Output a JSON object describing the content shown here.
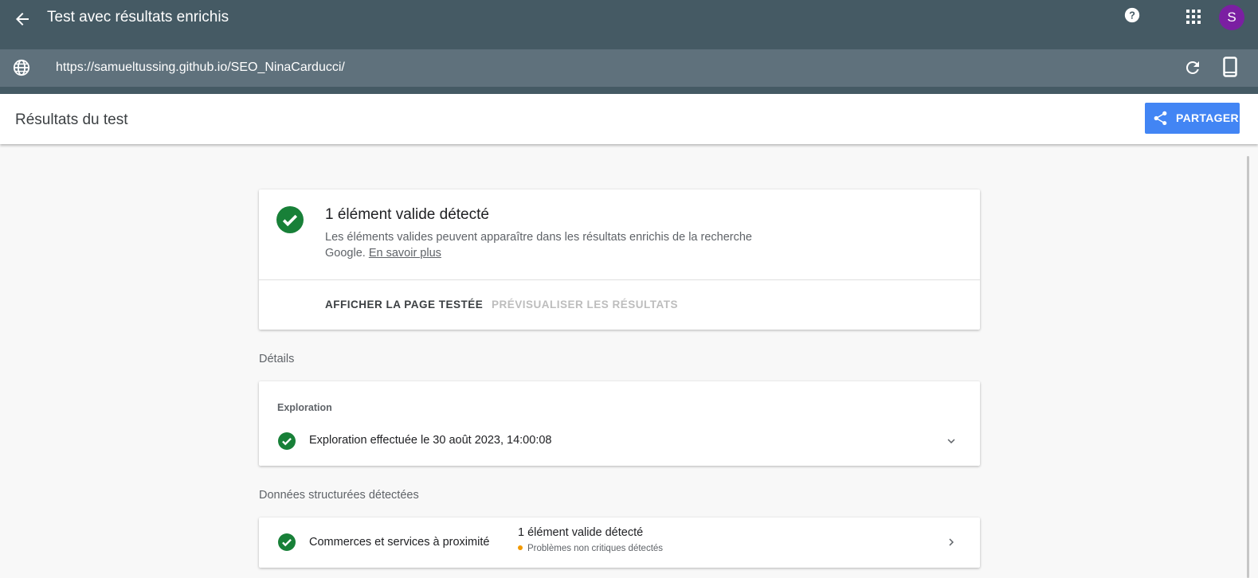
{
  "header": {
    "title": "Test avec résultats enrichis",
    "avatar_letter": "S",
    "icons": {
      "back": "arrow-back-icon",
      "help": "help-icon",
      "apps": "apps-grid-icon"
    },
    "avatar_color": "#7b1fa2"
  },
  "urlbar": {
    "url": "https://samueltussing.github.io/SEO_NinaCarducci/",
    "icons": {
      "globe": "globe-icon",
      "refresh": "refresh-icon",
      "device": "smartphone-icon"
    }
  },
  "results_bar": {
    "title": "Résultats du test",
    "share_label": "PARTAGER",
    "share_color": "#4285f4"
  },
  "summary_card": {
    "heading": "1 élément valide détecté",
    "description": "Les éléments valides peuvent apparaître dans les résultats enrichis de la recherche Google.",
    "learn_more": "En savoir plus",
    "action_view_page": "AFFICHER LA PAGE TESTÉE",
    "action_preview": "PRÉVISUALISER LES RÉSULTATS",
    "success_color": "#188038"
  },
  "details": {
    "section_label": "Détails",
    "crawl_title": "Exploration",
    "crawl_text": "Exploration effectuée le 30 août 2023, 14:00:08"
  },
  "structured_data": {
    "section_label": "Données structurées détectées",
    "items": [
      {
        "name": "Commerces et services à proximité",
        "status": "1 élément valide détecté",
        "warning": "Problèmes non critiques détectés",
        "warning_color": "#f29900"
      }
    ]
  }
}
